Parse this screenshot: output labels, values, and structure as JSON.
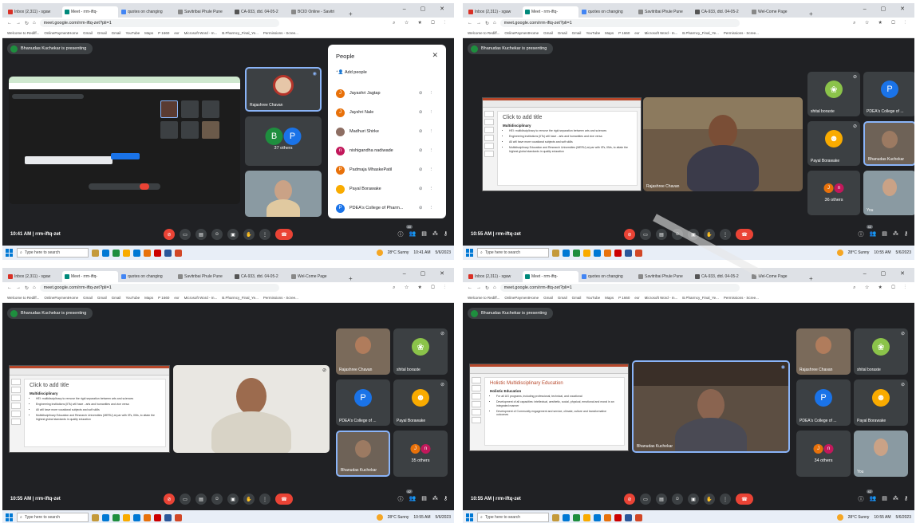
{
  "browser": {
    "tabs": [
      "Inbox (2,311) - sgaw",
      "Meet - rrm-iftq-",
      "quotes on changing",
      "Savitribai Phule Pune",
      "CA-933, dtd. 04-05-2",
      "Wel-Come Page"
    ],
    "tabs_p1": [
      "Inbox (2,311) - sgaw",
      "Meet - rrm-iftq-",
      "quotes on changing",
      "Savitribai Phule Pune",
      "CA-933, dtd. 04-05-2",
      "BCID Online - Savitri"
    ],
    "url": "meet.google.com/rrm-iftq-zet?pli=1",
    "bookmarks": [
      "Welcome to Rediff...",
      "OnlinePaymentHome",
      "Gmail",
      "Gmail",
      "Gmail",
      "YouTube",
      "Maps",
      "P 1660",
      "exr",
      "Microsoft Word - In...",
      "B.Pharmcy_Final_Ye...",
      "Permissions - Scree..."
    ]
  },
  "meeting": {
    "presenting": "Bhanudas Kuchekar is presenting",
    "code": "rrm-iftq-zet",
    "time_p1": "10:41 AM",
    "time": "10:55 AM",
    "participant_count_p1": "40",
    "participant_count": "42"
  },
  "panel1": {
    "tile_name": "Rajashree Chavan",
    "others_label": "37 others",
    "people": {
      "title": "People",
      "add": "Add people",
      "list": [
        "Jayashri Jagtap",
        "Jayshri Nale",
        "Madhuri Shirke",
        "nishigandha nadiwade",
        "Padmaja MhaskePatil",
        "Payal Borawake",
        "PDEA's College of Pharm..."
      ]
    }
  },
  "panel2": {
    "video_name": "Rajashree Chavan",
    "tiles": [
      "shital boraste",
      "PDEA's College of ...",
      "Payal Borawake",
      "Bhanudas Kuchekar",
      "36 others",
      "You"
    ]
  },
  "panel3": {
    "tiles": [
      "Rajashree Chavan",
      "shital boraste",
      "PDEA's College of ...",
      "Payal Borawake",
      "Bhanudas Kuchekar",
      "35 others"
    ]
  },
  "panel4": {
    "video_name": "Bhanudas Kuchekar",
    "tiles": [
      "Rajashree Chavan",
      "shital boraste",
      "PDEA's College of ...",
      "Payal Borawake",
      "34 others",
      "You"
    ]
  },
  "slide": {
    "title": "Click to add title",
    "heading": "Multidisciplinary",
    "bullets": [
      "HEI: multidisciplinary to remove the rigid separation between arts and sciences",
      "Engineering institutions (IITs) will have - arts and humanities and vice versa",
      "All will have more vocational subjects and soft skills",
      "Multidisciplinary Education and Research Universities (MERU) at par with IITs, IIMs, to attain the highest global standards in quality education"
    ]
  },
  "slide4": {
    "title": "Holistic Multidisciplinary Education",
    "heading": "Holistic Education",
    "bullets": [
      "For all UG programs, including professional, technical, and vocational",
      "Development of all capacities: intellectual, aesthetic, social, physical, emotional and moral in an integrated manner",
      "Development of Community engagement and service, climate, culture and transformative outcomes"
    ]
  },
  "taskbar": {
    "search": "Type here to search",
    "weather": "28°C Sunny",
    "clock_p1": "10:41 AM",
    "clock": "10:55 AM",
    "date": "5/6/2023"
  },
  "colors": {
    "red": "#ea4335",
    "meet_bg": "#202124",
    "tile": "#3c4043",
    "blue": "#1a73e8"
  }
}
